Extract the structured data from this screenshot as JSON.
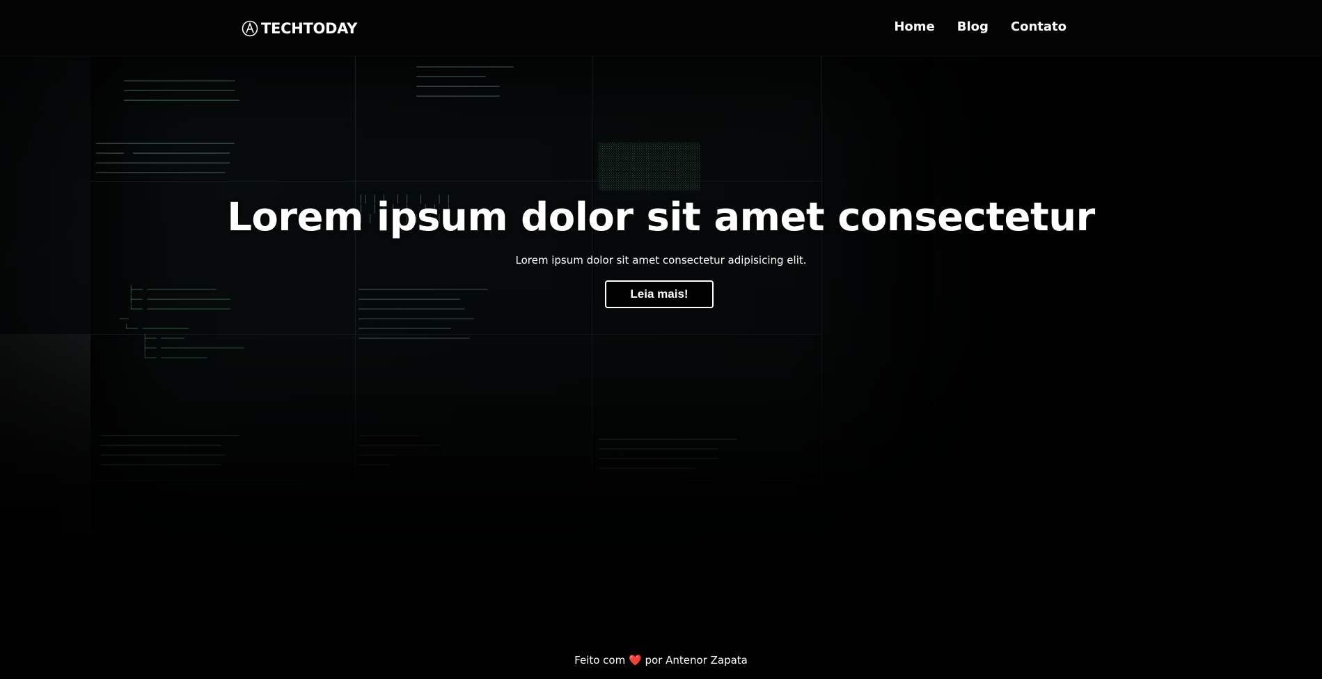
{
  "header": {
    "logo_text": "TECHTODAY",
    "logo_icon": "brand-a-icon",
    "nav": [
      {
        "label": "Home"
      },
      {
        "label": "Blog"
      },
      {
        "label": "Contato"
      }
    ]
  },
  "hero": {
    "title": "Lorem ipsum dolor sit amet consectetur",
    "subtitle": "Lorem ipsum dolor sit amet consectetur adipisicing elit.",
    "cta_label": "Leia mais!"
  },
  "footer": {
    "prefix": "Feito com",
    "heart": "❤️",
    "suffix": "por Antenor Zapata"
  },
  "colors": {
    "background": "#000000",
    "text": "#ffffff",
    "heart": "#e0312e"
  }
}
